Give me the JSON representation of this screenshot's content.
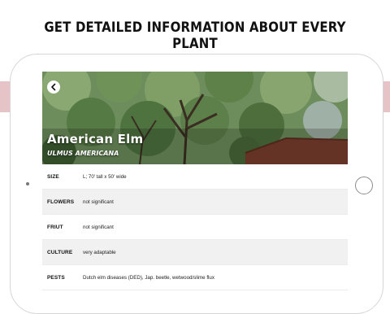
{
  "headline": "GET DETAILED INFORMATION ABOUT EVERY PLANT",
  "plant": {
    "name": "American Elm",
    "latin_name": "ULMUS AMERICANA"
  },
  "details": [
    {
      "label": "SIZE",
      "value": "L; 70' tall x 50' wide"
    },
    {
      "label": "FLOWERS",
      "value": "not significant"
    },
    {
      "label": "FRIUT",
      "value": "not significant"
    },
    {
      "label": "CULTURE",
      "value": "very adaptable"
    },
    {
      "label": "PESTS",
      "value": "Dutch elm diseases (DED), Jap. beetle, wetwood/slime flux"
    }
  ],
  "icons": {
    "back": "chevron-left-icon",
    "home": "home-button-icon",
    "camera": "camera-icon"
  },
  "colors": {
    "accent_band": "#e6c3c7",
    "row_alt": "#f1f1f1",
    "foliage": "#58794a"
  }
}
